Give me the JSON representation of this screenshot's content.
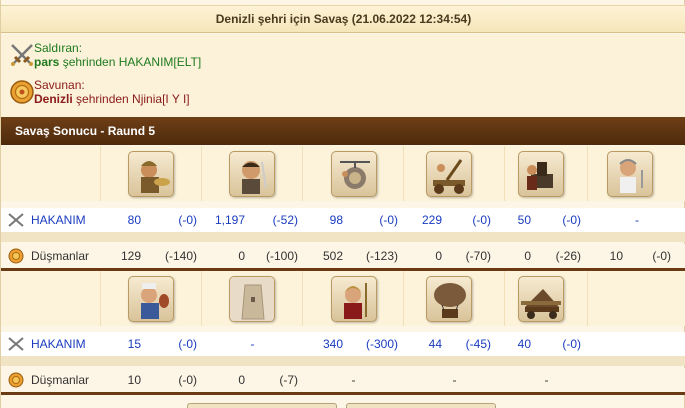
{
  "window": {
    "title": "Denizli şehri için Savaş (21.06.2022 12:34:54)"
  },
  "attacker": {
    "label": "Saldıran:",
    "city": "pars",
    "city_suffix": "şehrinden HAKANIM[ELT]",
    "icon": "crossed-swords-icon"
  },
  "defender": {
    "label": "Savunan:",
    "city": "Denizli",
    "city_suffix": "şehrinden Njinia[I Y I]",
    "icon": "shield-icon"
  },
  "result": {
    "title": "Savaş Sonucu - Raund 5"
  },
  "colors": {
    "header_brown": "#5c3310",
    "attacker_blue": "#1a3bc0",
    "attacker_green": "#1f7a1f",
    "defender_red": "#8b1a1a"
  },
  "block1": {
    "units": [
      "hoplite-unit-icon",
      "swordsman-unit-icon",
      "gyrocopter-unit-icon",
      "catapult-unit-icon",
      "mortar-unit-icon",
      "doctor-unit-icon"
    ],
    "attacker_name": "HAKANIM",
    "defender_name": "Düşmanlar",
    "attacker": [
      {
        "n": "80",
        "d": "(-0)"
      },
      {
        "n": "1,197",
        "d": "(-52)"
      },
      {
        "n": "98",
        "d": "(-0)"
      },
      {
        "n": "229",
        "d": "(-0)"
      },
      {
        "n": "50",
        "d": "(-0)"
      },
      {
        "n": "-",
        "d": ""
      }
    ],
    "defender": [
      {
        "n": "129",
        "d": "(-140)"
      },
      {
        "n": "0",
        "d": "(-100)"
      },
      {
        "n": "502",
        "d": "(-123)"
      },
      {
        "n": "0",
        "d": "(-70)"
      },
      {
        "n": "0",
        "d": "(-26)"
      },
      {
        "n": "10",
        "d": "(-0)"
      }
    ]
  },
  "block2": {
    "units": [
      "cook-unit-icon",
      "wall-unit-icon",
      "spartan-unit-icon",
      "balloon-unit-icon",
      "ram-unit-icon"
    ],
    "attacker_name": "HAKANIM",
    "defender_name": "Düşmanlar",
    "attacker": [
      {
        "n": "15",
        "d": "(-0)"
      },
      {
        "n": "-",
        "d": ""
      },
      {
        "n": "340",
        "d": "(-300)"
      },
      {
        "n": "44",
        "d": "(-45)"
      },
      {
        "n": "40",
        "d": "(-0)"
      }
    ],
    "defender": [
      {
        "n": "10",
        "d": "(-0)"
      },
      {
        "n": "0",
        "d": "(-7)"
      },
      {
        "n": "-",
        "d": ""
      },
      {
        "n": "-",
        "d": ""
      },
      {
        "n": "-",
        "d": ""
      }
    ]
  }
}
